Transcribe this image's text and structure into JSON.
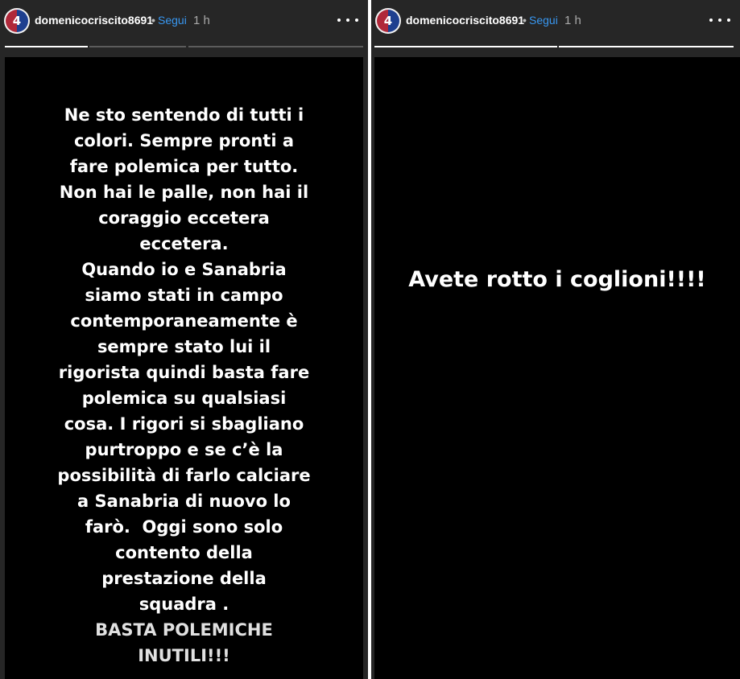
{
  "stories": [
    {
      "header": {
        "username": "domenicocriscito8691",
        "separator": "•",
        "follow_label": "Segui",
        "time": "1 h",
        "avatar_number": "4"
      },
      "progress": [
        1.0,
        0.0
      ],
      "text_lines": [
        "Ne sto sentendo di tutti i",
        "colori. Sempre pronti a",
        "fare polemica per tutto.",
        "Non hai le palle, non hai il",
        "coraggio eccetera",
        "eccetera.",
        "Quando io e Sanabria",
        "siamo stati in campo",
        "contemporaneamente è",
        "sempre stato lui il",
        "rigorista quindi basta fare",
        "polemica su qualsiasi",
        "cosa. I rigori si sbagliano",
        "purtroppo e se c’è la",
        "possibilità di farlo calciare",
        "a Sanabria di nuovo lo",
        "farò.  Oggi sono solo",
        "contento della",
        "prestazione della",
        "squadra .",
        "BASTA POLEMICHE",
        "INUTILI!!!"
      ]
    },
    {
      "header": {
        "username": "domenicocriscito8691",
        "separator": "•",
        "follow_label": "Segui",
        "time": "1 h",
        "avatar_number": "4"
      },
      "progress": [
        1.0,
        1.0
      ],
      "text": "Avete rotto i coglioni!!!!"
    }
  ],
  "colors": {
    "panel_bg": "#262626",
    "story_bg": "#000000",
    "follow": "#3897f0",
    "time": "#a8a8a8"
  },
  "icons": [
    "avatar",
    "more-options-icon"
  ]
}
